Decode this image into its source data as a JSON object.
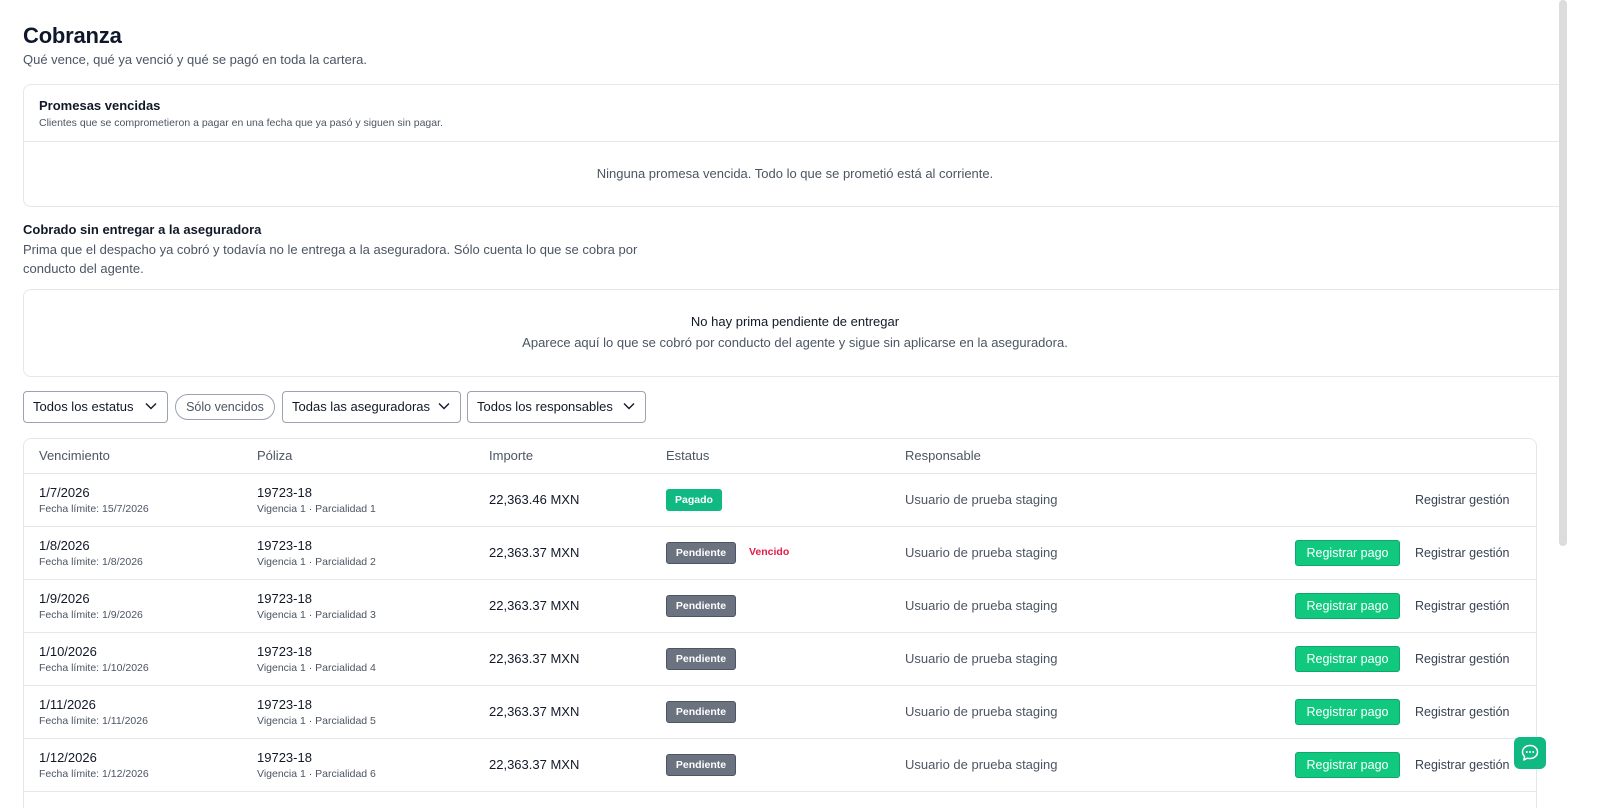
{
  "header": {
    "title": "Cobranza",
    "subtitle": "Qué vence, qué ya venció y qué se pagó en toda la cartera."
  },
  "promesas": {
    "title": "Promesas vencidas",
    "description": "Clientes que se comprometieron a pagar en una fecha que ya pasó y siguen sin pagar.",
    "empty_text": "Ninguna promesa vencida. Todo lo que se prometió está al corriente."
  },
  "cobrado": {
    "title": "Cobrado sin entregar a la aseguradora",
    "description": "Prima que el despacho ya cobró y todavía no le entrega a la aseguradora. Sólo cuenta lo que se cobra por conducto del agente.",
    "empty_title": "No hay prima pendiente de entregar",
    "empty_description": "Aparece aquí lo que se cobró por conducto del agente y sigue sin aplicarse en la aseguradora."
  },
  "filters": {
    "status": "Todos los estatus",
    "solo_vencidos": "Sólo vencidos",
    "aseguradoras": "Todas las aseguradoras",
    "responsables": "Todos los responsables"
  },
  "table": {
    "columns": {
      "vencimiento": "Vencimiento",
      "poliza": "Póliza",
      "importe": "Importe",
      "estatus": "Estatus",
      "responsable": "Responsable"
    },
    "rows": [
      {
        "fecha": "1/7/2026",
        "limite": "Fecha límite: 15/7/2026",
        "poliza": "19723-18",
        "detalle": "Vigencia 1 · Parcialidad 1",
        "importe": "22,363.46 MXN",
        "estatus": "Pagado",
        "vencido": "",
        "responsable": "Usuario de prueba staging",
        "pago": "",
        "gestion": "Registrar gestión"
      },
      {
        "fecha": "1/8/2026",
        "limite": "Fecha límite: 1/8/2026",
        "poliza": "19723-18",
        "detalle": "Vigencia 1 · Parcialidad 2",
        "importe": "22,363.37 MXN",
        "estatus": "Pendiente",
        "vencido": "Vencido",
        "responsable": "Usuario de prueba staging",
        "pago": "Registrar pago",
        "gestion": "Registrar gestión"
      },
      {
        "fecha": "1/9/2026",
        "limite": "Fecha límite: 1/9/2026",
        "poliza": "19723-18",
        "detalle": "Vigencia 1 · Parcialidad 3",
        "importe": "22,363.37 MXN",
        "estatus": "Pendiente",
        "vencido": "",
        "responsable": "Usuario de prueba staging",
        "pago": "Registrar pago",
        "gestion": "Registrar gestión"
      },
      {
        "fecha": "1/10/2026",
        "limite": "Fecha límite: 1/10/2026",
        "poliza": "19723-18",
        "detalle": "Vigencia 1 · Parcialidad 4",
        "importe": "22,363.37 MXN",
        "estatus": "Pendiente",
        "vencido": "",
        "responsable": "Usuario de prueba staging",
        "pago": "Registrar pago",
        "gestion": "Registrar gestión"
      },
      {
        "fecha": "1/11/2026",
        "limite": "Fecha límite: 1/11/2026",
        "poliza": "19723-18",
        "detalle": "Vigencia 1 · Parcialidad 5",
        "importe": "22,363.37 MXN",
        "estatus": "Pendiente",
        "vencido": "",
        "responsable": "Usuario de prueba staging",
        "pago": "Registrar pago",
        "gestion": "Registrar gestión"
      },
      {
        "fecha": "1/12/2026",
        "limite": "Fecha límite: 1/12/2026",
        "poliza": "19723-18",
        "detalle": "Vigencia 1 · Parcialidad 6",
        "importe": "22,363.37 MXN",
        "estatus": "Pendiente",
        "vencido": "",
        "responsable": "Usuario de prueba staging",
        "pago": "Registrar pago",
        "gestion": "Registrar gestión"
      }
    ]
  },
  "chat": {
    "icon": "chat-bubble-icon"
  },
  "colors": {
    "accent": "#10b981",
    "pending": "#6b7280",
    "overdue": "#e11d48"
  }
}
